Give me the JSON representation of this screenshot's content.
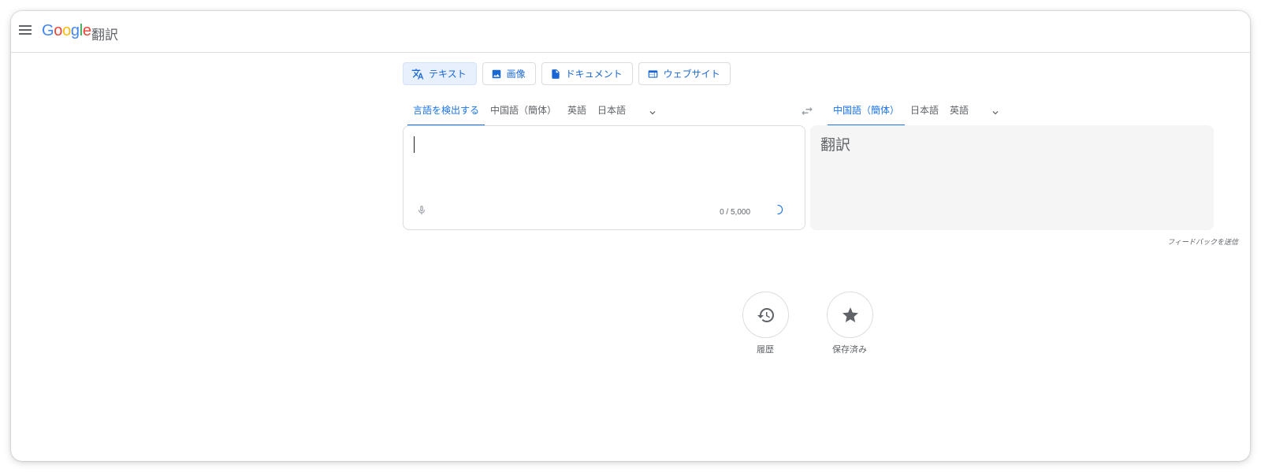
{
  "header": {
    "logo_text": "Google",
    "product_name": "翻訳"
  },
  "mode_tabs": [
    {
      "label": "テキスト",
      "icon": "translate-icon",
      "active": true
    },
    {
      "label": "画像",
      "icon": "image-icon",
      "active": false
    },
    {
      "label": "ドキュメント",
      "icon": "document-icon",
      "active": false
    },
    {
      "label": "ウェブサイト",
      "icon": "website-icon",
      "active": false
    }
  ],
  "source_languages": [
    {
      "label": "言語を検出する",
      "active": true
    },
    {
      "label": "中国語（簡体）",
      "active": false
    },
    {
      "label": "英語",
      "active": false
    },
    {
      "label": "日本語",
      "active": false
    }
  ],
  "target_languages": [
    {
      "label": "中国語（簡体）",
      "active": true
    },
    {
      "label": "日本語",
      "active": false
    },
    {
      "label": "英語",
      "active": false
    }
  ],
  "source_box": {
    "value": "",
    "char_count": "0 / 5,000"
  },
  "target_box": {
    "placeholder": "翻訳"
  },
  "feedback_label": "フィードバックを送信",
  "bottom_actions": {
    "history_label": "履歴",
    "saved_label": "保存済み"
  },
  "colors": {
    "accent": "#1a73e8",
    "active_tab_bg": "#e8f0fe",
    "target_bg": "#f5f5f5"
  }
}
